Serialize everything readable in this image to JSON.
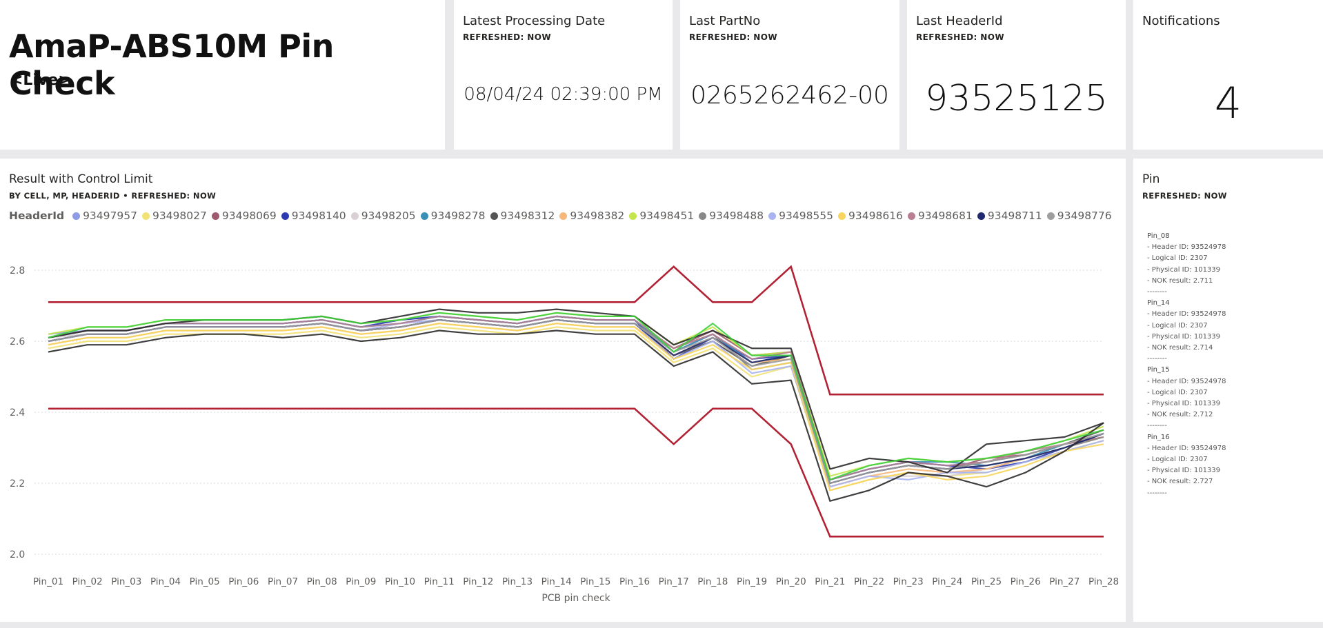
{
  "header": {
    "title": "AmaP-ABS10M Pin Check",
    "subtitle": "<Live>"
  },
  "cards": {
    "date": {
      "title": "Latest Processing Date",
      "sub": "REFRESHED: NOW",
      "value": "08/04/24 02:39:00 PM"
    },
    "part": {
      "title": "Last PartNo",
      "sub": "REFRESHED: NOW",
      "value": "0265262462-00"
    },
    "header": {
      "title": "Last HeaderId",
      "sub": "REFRESHED: NOW",
      "value": "93525125"
    },
    "notif": {
      "title": "Notifications",
      "sub": "",
      "value": "4"
    }
  },
  "chart": {
    "title": "Result with Control Limit",
    "sub": "BY CELL, MP, HEADERID  •  REFRESHED: NOW",
    "legend_title": "HeaderId"
  },
  "chart_data": {
    "type": "line",
    "title": "Result with Control Limit",
    "xlabel": "PCB pin check",
    "ylabel": "",
    "ylim": [
      2.0,
      2.8
    ],
    "yticks": [
      "2.0",
      "2.2",
      "2.4",
      "2.6",
      "2.8"
    ],
    "grid": true,
    "legend_position": "top-left",
    "categories": [
      "Pin_01",
      "Pin_02",
      "Pin_03",
      "Pin_04",
      "Pin_05",
      "Pin_06",
      "Pin_07",
      "Pin_08",
      "Pin_09",
      "Pin_10",
      "Pin_11",
      "Pin_12",
      "Pin_13",
      "Pin_14",
      "Pin_15",
      "Pin_16",
      "Pin_17",
      "Pin_18",
      "Pin_19",
      "Pin_20",
      "Pin_21",
      "Pin_22",
      "Pin_23",
      "Pin_24",
      "Pin_25",
      "Pin_26",
      "Pin_27",
      "Pin_28"
    ],
    "upper_limit": [
      2.71,
      2.71,
      2.71,
      2.71,
      2.71,
      2.71,
      2.71,
      2.71,
      2.71,
      2.71,
      2.71,
      2.71,
      2.71,
      2.71,
      2.71,
      2.71,
      2.81,
      2.71,
      2.71,
      2.81,
      2.45,
      2.45,
      2.45,
      2.45,
      2.45,
      2.45,
      2.45,
      2.45
    ],
    "lower_limit": [
      2.41,
      2.41,
      2.41,
      2.41,
      2.41,
      2.41,
      2.41,
      2.41,
      2.41,
      2.41,
      2.41,
      2.41,
      2.41,
      2.41,
      2.41,
      2.41,
      2.31,
      2.41,
      2.41,
      2.31,
      2.05,
      2.05,
      2.05,
      2.05,
      2.05,
      2.05,
      2.05,
      2.05
    ],
    "limit_color": "#b22234",
    "series": [
      {
        "name": "93497957",
        "color": "#8d9be6",
        "values": [
          2.62,
          2.63,
          2.63,
          2.65,
          2.65,
          2.65,
          2.65,
          2.66,
          2.64,
          2.66,
          2.67,
          2.66,
          2.65,
          2.67,
          2.66,
          2.66,
          2.57,
          2.62,
          2.54,
          2.56,
          2.21,
          2.24,
          2.26,
          2.25,
          2.26,
          2.28,
          2.31,
          2.34
        ]
      },
      {
        "name": "93498027",
        "color": "#f2e176",
        "values": [
          2.58,
          2.6,
          2.6,
          2.62,
          2.62,
          2.62,
          2.62,
          2.63,
          2.61,
          2.62,
          2.64,
          2.63,
          2.62,
          2.64,
          2.63,
          2.63,
          2.54,
          2.58,
          2.5,
          2.53,
          2.18,
          2.21,
          2.23,
          2.22,
          2.23,
          2.26,
          2.29,
          2.32
        ]
      },
      {
        "name": "93498069",
        "color": "#9e5a6e",
        "values": [
          2.6,
          2.62,
          2.62,
          2.64,
          2.64,
          2.64,
          2.64,
          2.65,
          2.63,
          2.64,
          2.66,
          2.65,
          2.64,
          2.66,
          2.65,
          2.65,
          2.58,
          2.63,
          2.56,
          2.57,
          2.2,
          2.23,
          2.25,
          2.24,
          2.27,
          2.28,
          2.31,
          2.33
        ]
      },
      {
        "name": "93498140",
        "color": "#2c3cb0",
        "values": [
          2.61,
          2.63,
          2.63,
          2.65,
          2.65,
          2.65,
          2.65,
          2.66,
          2.64,
          2.66,
          2.67,
          2.66,
          2.65,
          2.67,
          2.66,
          2.66,
          2.55,
          2.61,
          2.55,
          2.56,
          2.21,
          2.24,
          2.26,
          2.25,
          2.24,
          2.26,
          2.3,
          2.34
        ]
      },
      {
        "name": "93498205",
        "color": "#d9cfd4",
        "values": [
          2.61,
          2.62,
          2.62,
          2.64,
          2.64,
          2.64,
          2.64,
          2.65,
          2.63,
          2.65,
          2.66,
          2.65,
          2.64,
          2.66,
          2.65,
          2.65,
          2.56,
          2.6,
          2.53,
          2.55,
          2.19,
          2.22,
          2.22,
          2.22,
          2.24,
          2.27,
          2.3,
          2.33
        ]
      },
      {
        "name": "93498278",
        "color": "#3a8fb7",
        "values": [
          2.61,
          2.63,
          2.63,
          2.65,
          2.65,
          2.65,
          2.65,
          2.66,
          2.64,
          2.65,
          2.67,
          2.66,
          2.65,
          2.67,
          2.66,
          2.66,
          2.57,
          2.62,
          2.54,
          2.56,
          2.21,
          2.24,
          2.26,
          2.26,
          2.25,
          2.27,
          2.31,
          2.34
        ]
      },
      {
        "name": "93498312",
        "color": "#555555",
        "values": [
          2.6,
          2.62,
          2.62,
          2.64,
          2.64,
          2.64,
          2.64,
          2.65,
          2.63,
          2.64,
          2.66,
          2.65,
          2.64,
          2.66,
          2.65,
          2.65,
          2.56,
          2.6,
          2.53,
          2.56,
          2.2,
          2.23,
          2.25,
          2.24,
          2.26,
          2.28,
          2.31,
          2.35
        ]
      },
      {
        "name": "93498382",
        "color": "#f5b87a",
        "values": [
          2.59,
          2.61,
          2.61,
          2.63,
          2.63,
          2.63,
          2.63,
          2.64,
          2.62,
          2.63,
          2.65,
          2.64,
          2.63,
          2.65,
          2.64,
          2.64,
          2.56,
          2.61,
          2.54,
          2.55,
          2.19,
          2.22,
          2.24,
          2.23,
          2.24,
          2.27,
          2.3,
          2.33
        ]
      },
      {
        "name": "93498451",
        "color": "#c4e64a",
        "values": [
          2.62,
          2.64,
          2.64,
          2.66,
          2.66,
          2.66,
          2.66,
          2.67,
          2.65,
          2.66,
          2.68,
          2.67,
          2.66,
          2.68,
          2.67,
          2.67,
          2.59,
          2.64,
          2.56,
          2.57,
          2.22,
          2.25,
          2.27,
          2.26,
          2.27,
          2.29,
          2.32,
          2.36
        ]
      },
      {
        "name": "93498488",
        "color": "#888888",
        "values": [
          2.6,
          2.62,
          2.62,
          2.64,
          2.64,
          2.64,
          2.64,
          2.65,
          2.63,
          2.64,
          2.66,
          2.65,
          2.64,
          2.66,
          2.65,
          2.65,
          2.58,
          2.62,
          2.52,
          2.54,
          2.2,
          2.23,
          2.25,
          2.24,
          2.25,
          2.27,
          2.3,
          2.33
        ]
      },
      {
        "name": "93498555",
        "color": "#aab4f0",
        "values": [
          2.6,
          2.62,
          2.62,
          2.64,
          2.64,
          2.64,
          2.64,
          2.65,
          2.63,
          2.65,
          2.66,
          2.65,
          2.64,
          2.66,
          2.65,
          2.65,
          2.55,
          2.6,
          2.51,
          2.53,
          2.19,
          2.22,
          2.21,
          2.23,
          2.23,
          2.26,
          2.29,
          2.32
        ]
      },
      {
        "name": "93498616",
        "color": "#f7d55e",
        "values": [
          2.59,
          2.61,
          2.61,
          2.63,
          2.63,
          2.63,
          2.63,
          2.64,
          2.62,
          2.63,
          2.65,
          2.64,
          2.63,
          2.65,
          2.64,
          2.64,
          2.55,
          2.59,
          2.52,
          2.54,
          2.18,
          2.21,
          2.23,
          2.21,
          2.22,
          2.25,
          2.29,
          2.31
        ]
      },
      {
        "name": "93498681",
        "color": "#b87f91",
        "values": [
          2.61,
          2.63,
          2.63,
          2.65,
          2.65,
          2.65,
          2.65,
          2.66,
          2.64,
          2.65,
          2.67,
          2.66,
          2.65,
          2.67,
          2.66,
          2.66,
          2.58,
          2.62,
          2.55,
          2.57,
          2.21,
          2.24,
          2.26,
          2.25,
          2.26,
          2.29,
          2.31,
          2.34
        ]
      },
      {
        "name": "93498711",
        "color": "#1f2a6e",
        "values": [
          2.6,
          2.62,
          2.62,
          2.64,
          2.64,
          2.64,
          2.64,
          2.65,
          2.63,
          2.64,
          2.66,
          2.65,
          2.64,
          2.66,
          2.65,
          2.65,
          2.56,
          2.61,
          2.54,
          2.56,
          2.2,
          2.23,
          2.25,
          2.24,
          2.25,
          2.27,
          2.3,
          2.34
        ]
      },
      {
        "name": "93498776",
        "color": "#9e9e9e",
        "values": [
          2.6,
          2.62,
          2.62,
          2.64,
          2.64,
          2.64,
          2.64,
          2.65,
          2.63,
          2.64,
          2.66,
          2.65,
          2.64,
          2.66,
          2.65,
          2.65,
          2.57,
          2.61,
          2.53,
          2.55,
          2.2,
          2.23,
          2.25,
          2.24,
          2.26,
          2.28,
          2.31,
          2.34
        ]
      },
      {
        "name": "",
        "color": "#2a2a2a",
        "values": [
          2.57,
          2.59,
          2.59,
          2.61,
          2.62,
          2.62,
          2.61,
          2.62,
          2.6,
          2.61,
          2.63,
          2.62,
          2.62,
          2.63,
          2.62,
          2.62,
          2.53,
          2.57,
          2.48,
          2.49,
          2.15,
          2.18,
          2.23,
          2.22,
          2.19,
          2.23,
          2.29,
          2.37
        ]
      },
      {
        "name": "",
        "color": "#2a2a2a",
        "values": [
          2.61,
          2.63,
          2.63,
          2.65,
          2.66,
          2.66,
          2.66,
          2.67,
          2.65,
          2.67,
          2.69,
          2.68,
          2.68,
          2.69,
          2.68,
          2.67,
          2.59,
          2.63,
          2.58,
          2.58,
          2.24,
          2.27,
          2.26,
          2.23,
          2.31,
          2.32,
          2.33,
          2.37
        ]
      },
      {
        "name": "",
        "color": "#3fcf3f",
        "values": [
          2.61,
          2.64,
          2.64,
          2.66,
          2.66,
          2.66,
          2.66,
          2.67,
          2.65,
          2.66,
          2.68,
          2.67,
          2.66,
          2.68,
          2.67,
          2.67,
          2.57,
          2.65,
          2.56,
          2.56,
          2.21,
          2.25,
          2.27,
          2.26,
          2.27,
          2.29,
          2.32,
          2.35
        ]
      }
    ]
  },
  "pin_panel": {
    "title": "Pin",
    "sub": "REFRESHED: NOW",
    "lines": [
      "Pin_08",
      "- Header ID: 93524978",
      "- Logical ID: 2307",
      "- Physical ID: 101339",
      "- NOK result: 2.711",
      "--------",
      "Pin_14",
      "- Header ID: 93524978",
      "- Logical ID: 2307",
      "- Physical ID: 101339",
      "- NOK result: 2.714",
      "--------",
      "Pin_15",
      "- Header ID: 93524978",
      "- Logical ID: 2307",
      "- Physical ID: 101339",
      "- NOK result: 2.712",
      "--------",
      "Pin_16",
      "- Header ID: 93524978",
      "- Logical ID: 2307",
      "- Physical ID: 101339",
      "- NOK result: 2.727",
      "--------"
    ]
  }
}
